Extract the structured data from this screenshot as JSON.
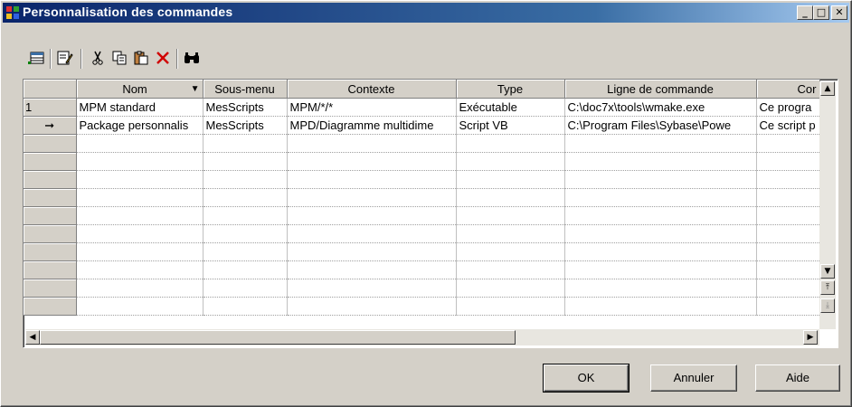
{
  "window": {
    "title": "Personnalisation des commandes"
  },
  "titlebar_buttons": {
    "minimize": "_",
    "maximize": "□",
    "close": "✕"
  },
  "toolbar": {
    "icons": [
      "properties-icon",
      "edit-icon",
      "cut-icon",
      "copy-icon",
      "paste-icon",
      "delete-icon",
      "find-icon"
    ]
  },
  "grid": {
    "columns": [
      "Nom",
      "Sous-menu",
      "Contexte",
      "Type",
      "Ligne de commande",
      "Cor"
    ],
    "rows": [
      {
        "marker": "1",
        "cells": [
          "MPM standard",
          "MesScripts",
          "MPM/*/*",
          "Exécutable",
          "C:\\doc7x\\tools\\wmake.exe",
          "Ce progra"
        ]
      },
      {
        "marker": "➞",
        "cells": [
          "Package personnalis",
          "MesScripts",
          "MPD/Diagramme multidime",
          "Script VB",
          "C:\\Program Files\\Sybase\\Powe",
          "Ce script p"
        ]
      }
    ],
    "empty_row_count": 10
  },
  "buttons": {
    "ok": "OK",
    "cancel": "Annuler",
    "help": "Aide"
  },
  "colors": {
    "title_start": "#0a246a",
    "title_end": "#a6caf0",
    "face": "#d4d0c8",
    "delete_red": "#d00000"
  }
}
